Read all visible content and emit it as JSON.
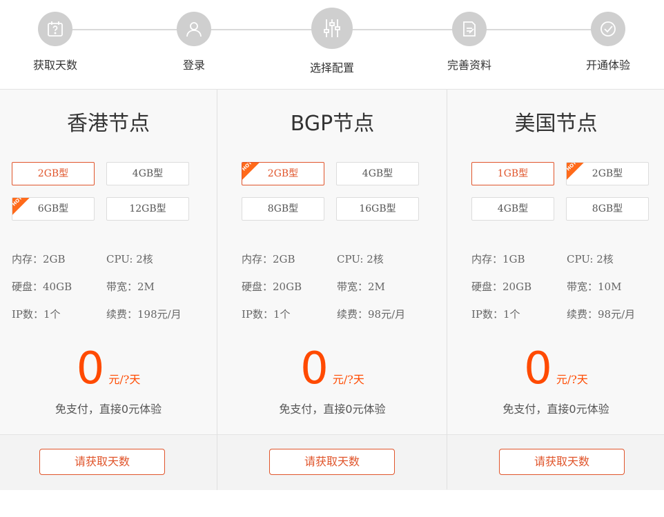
{
  "steps": [
    {
      "label": "获取天数",
      "icon": "calendar-question-icon"
    },
    {
      "label": "登录",
      "icon": "user-icon"
    },
    {
      "label": "选择配置",
      "icon": "sliders-icon"
    },
    {
      "label": "完善资料",
      "icon": "edit-document-icon"
    },
    {
      "label": "开通体验",
      "icon": "check-circle-icon"
    }
  ],
  "accent_color": "#ff4a00",
  "plans": [
    {
      "title": "香港节点",
      "options": [
        {
          "label": "2GB型",
          "selected": true,
          "hot": false
        },
        {
          "label": "4GB型",
          "selected": false,
          "hot": false
        },
        {
          "label": "6GB型",
          "selected": false,
          "hot": true
        },
        {
          "label": "12GB型",
          "selected": false,
          "hot": false
        }
      ],
      "specs": {
        "memory": "内存：2GB",
        "cpu": "CPU:  2核",
        "disk": "硬盘：40GB",
        "bandwidth": "带宽：2M",
        "ip": "IP数：1个",
        "renewal": "续费：198元/月"
      },
      "price": "0",
      "unit": "元/?天",
      "note": "免支付，直接0元体验",
      "button": "请获取天数"
    },
    {
      "title": "BGP节点",
      "options": [
        {
          "label": "2GB型",
          "selected": true,
          "hot": true
        },
        {
          "label": "4GB型",
          "selected": false,
          "hot": false
        },
        {
          "label": "8GB型",
          "selected": false,
          "hot": false
        },
        {
          "label": "16GB型",
          "selected": false,
          "hot": false
        }
      ],
      "specs": {
        "memory": "内存：2GB",
        "cpu": "CPU:  2核",
        "disk": "硬盘：20GB",
        "bandwidth": "带宽：2M",
        "ip": "IP数：1个",
        "renewal": "续费：98元/月"
      },
      "price": "0",
      "unit": "元/?天",
      "note": "免支付，直接0元体验",
      "button": "请获取天数"
    },
    {
      "title": "美国节点",
      "options": [
        {
          "label": "1GB型",
          "selected": true,
          "hot": false
        },
        {
          "label": "2GB型",
          "selected": false,
          "hot": true
        },
        {
          "label": "4GB型",
          "selected": false,
          "hot": false
        },
        {
          "label": "8GB型",
          "selected": false,
          "hot": false
        }
      ],
      "specs": {
        "memory": "内存：1GB",
        "cpu": "CPU:  2核",
        "disk": "硬盘：20GB",
        "bandwidth": "带宽：10M",
        "ip": "IP数：1个",
        "renewal": "续费：98元/月"
      },
      "price": "0",
      "unit": "元/?天",
      "note": "免支付，直接0元体验",
      "button": "请获取天数"
    }
  ],
  "hot_badge": "HOT"
}
